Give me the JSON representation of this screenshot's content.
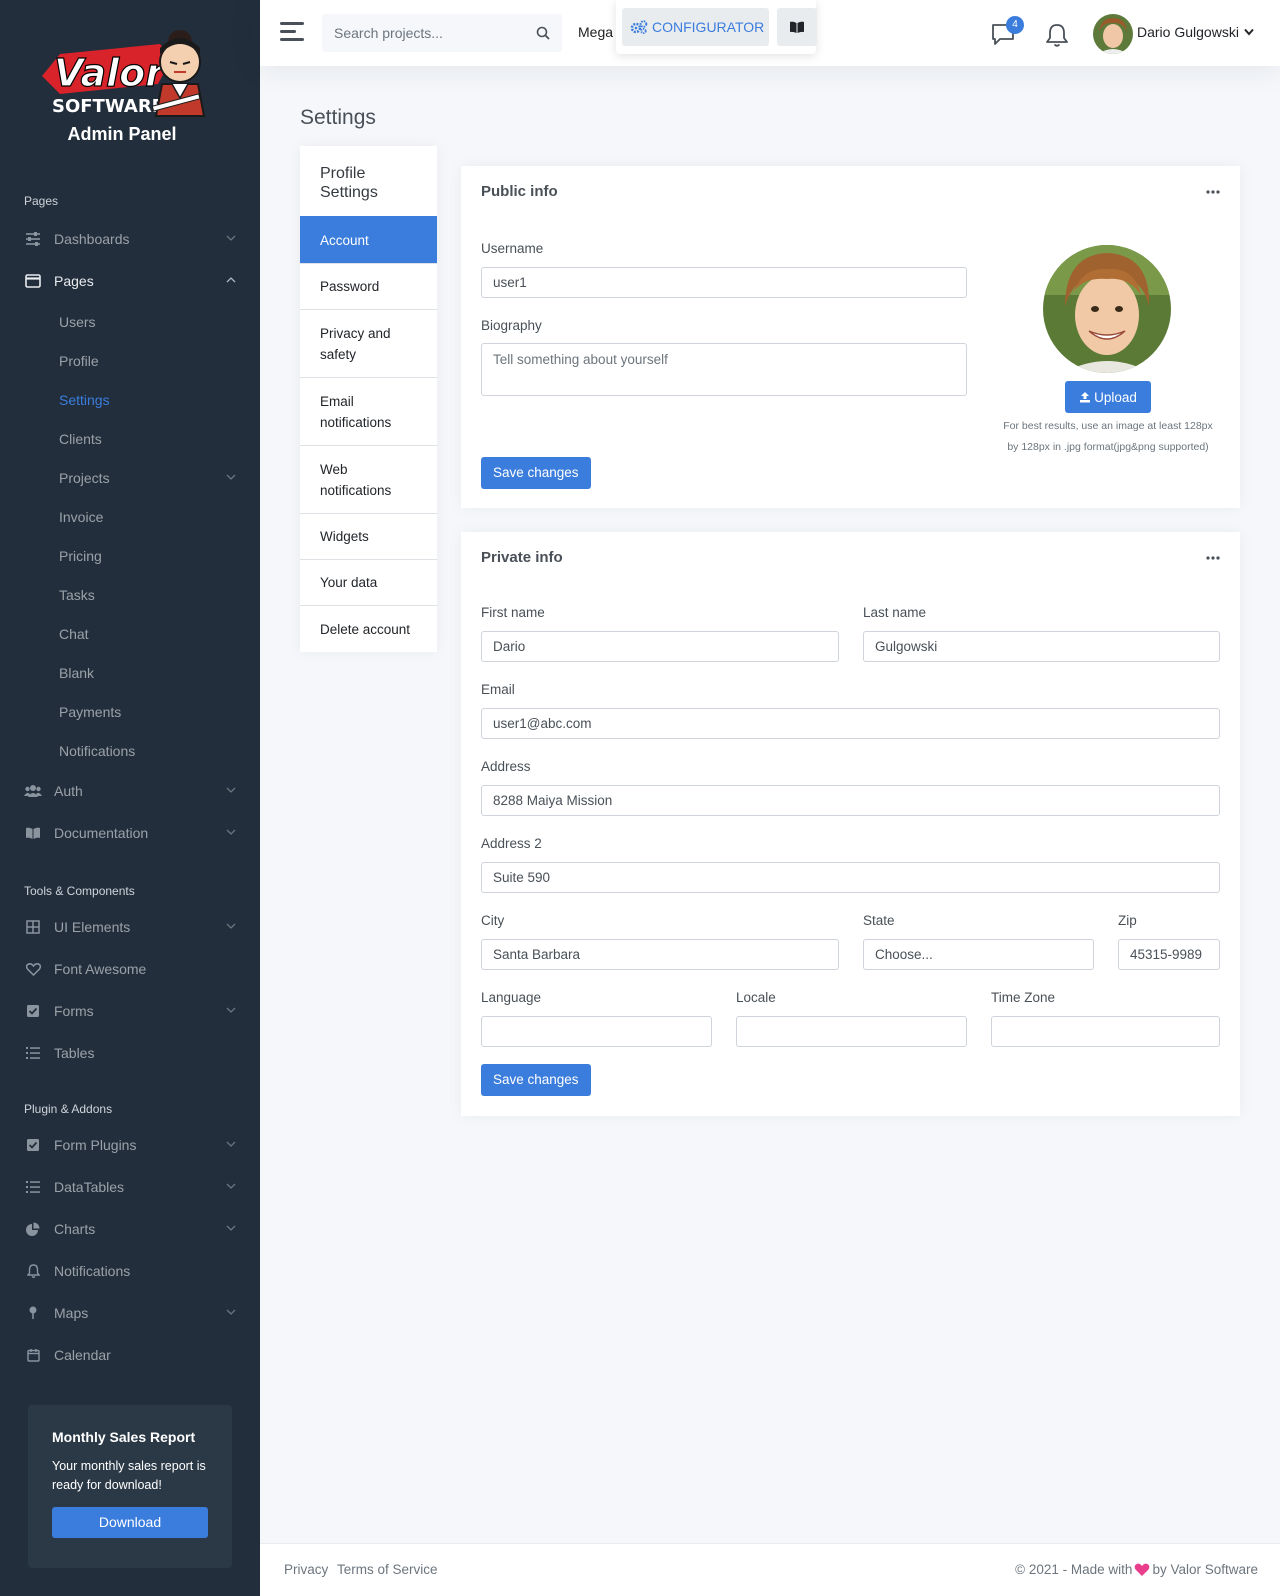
{
  "brand": {
    "logo_line1": "Valor",
    "logo_line2": "SOFTWARE",
    "title": "Admin Panel"
  },
  "sidebar": {
    "pages_header": "Pages",
    "dashboards": "Dashboards",
    "pages": "Pages",
    "pages_sub": [
      "Users",
      "Profile",
      "Settings",
      "Clients",
      "Projects",
      "Invoice",
      "Pricing",
      "Tasks",
      "Chat",
      "Blank",
      "Payments",
      "Notifications"
    ],
    "auth": "Auth",
    "documentation": "Documentation",
    "tools_header": "Tools & Components",
    "ui_elements": "UI Elements",
    "font_awesome": "Font Awesome",
    "forms": "Forms",
    "tables": "Tables",
    "plugins_header": "Plugin & Addons",
    "form_plugins": "Form Plugins",
    "datatables": "DataTables",
    "charts": "Charts",
    "notifications": "Notifications",
    "maps": "Maps",
    "calendar": "Calendar",
    "cta": {
      "title": "Monthly Sales Report",
      "text": "Your monthly sales report is ready for download!",
      "button": "Download"
    }
  },
  "topbar": {
    "search_placeholder": "Search projects...",
    "mega": "Mega",
    "configurator": "CONFIGURATOR",
    "message_count": "4",
    "user_name": "Dario Gulgowski"
  },
  "page_title": "Settings",
  "settings_nav": {
    "header": "Profile Settings",
    "items": [
      "Account",
      "Password",
      "Privacy and safety",
      "Email notifications",
      "Web notifications",
      "Widgets",
      "Your data",
      "Delete account"
    ]
  },
  "public_info": {
    "title": "Public info",
    "username_label": "Username",
    "username_value": "user1",
    "biography_label": "Biography",
    "biography_placeholder": "Tell something about yourself",
    "upload": "Upload",
    "hint_line1": "For best results, use an image at least 128px",
    "hint_line2": "by 128px in .jpg format(jpg&png supported)",
    "save": "Save changes"
  },
  "private_info": {
    "title": "Private info",
    "first_name_label": "First name",
    "first_name_value": "Dario",
    "last_name_label": "Last name",
    "last_name_value": "Gulgowski",
    "email_label": "Email",
    "email_value": "user1@abc.com",
    "address_label": "Address",
    "address_value": "8288 Maiya Mission",
    "address2_label": "Address 2",
    "address2_value": "Suite 590",
    "city_label": "City",
    "city_value": "Santa Barbara",
    "state_label": "State",
    "state_value": "Choose...",
    "zip_label": "Zip",
    "zip_value": "45315-9989",
    "language_label": "Language",
    "language_value": "",
    "locale_label": "Locale",
    "locale_value": "",
    "timezone_label": "Time Zone",
    "timezone_value": "",
    "save": "Save changes"
  },
  "footer": {
    "privacy": "Privacy",
    "terms": "Terms of Service",
    "copy_prefix": "© 2021 - Made with",
    "copy_suffix": "by Valor Software"
  },
  "colors": {
    "primary": "#3b7ddd",
    "sidebar_bg": "#222e3c",
    "page_bg": "#f5f7fb"
  }
}
